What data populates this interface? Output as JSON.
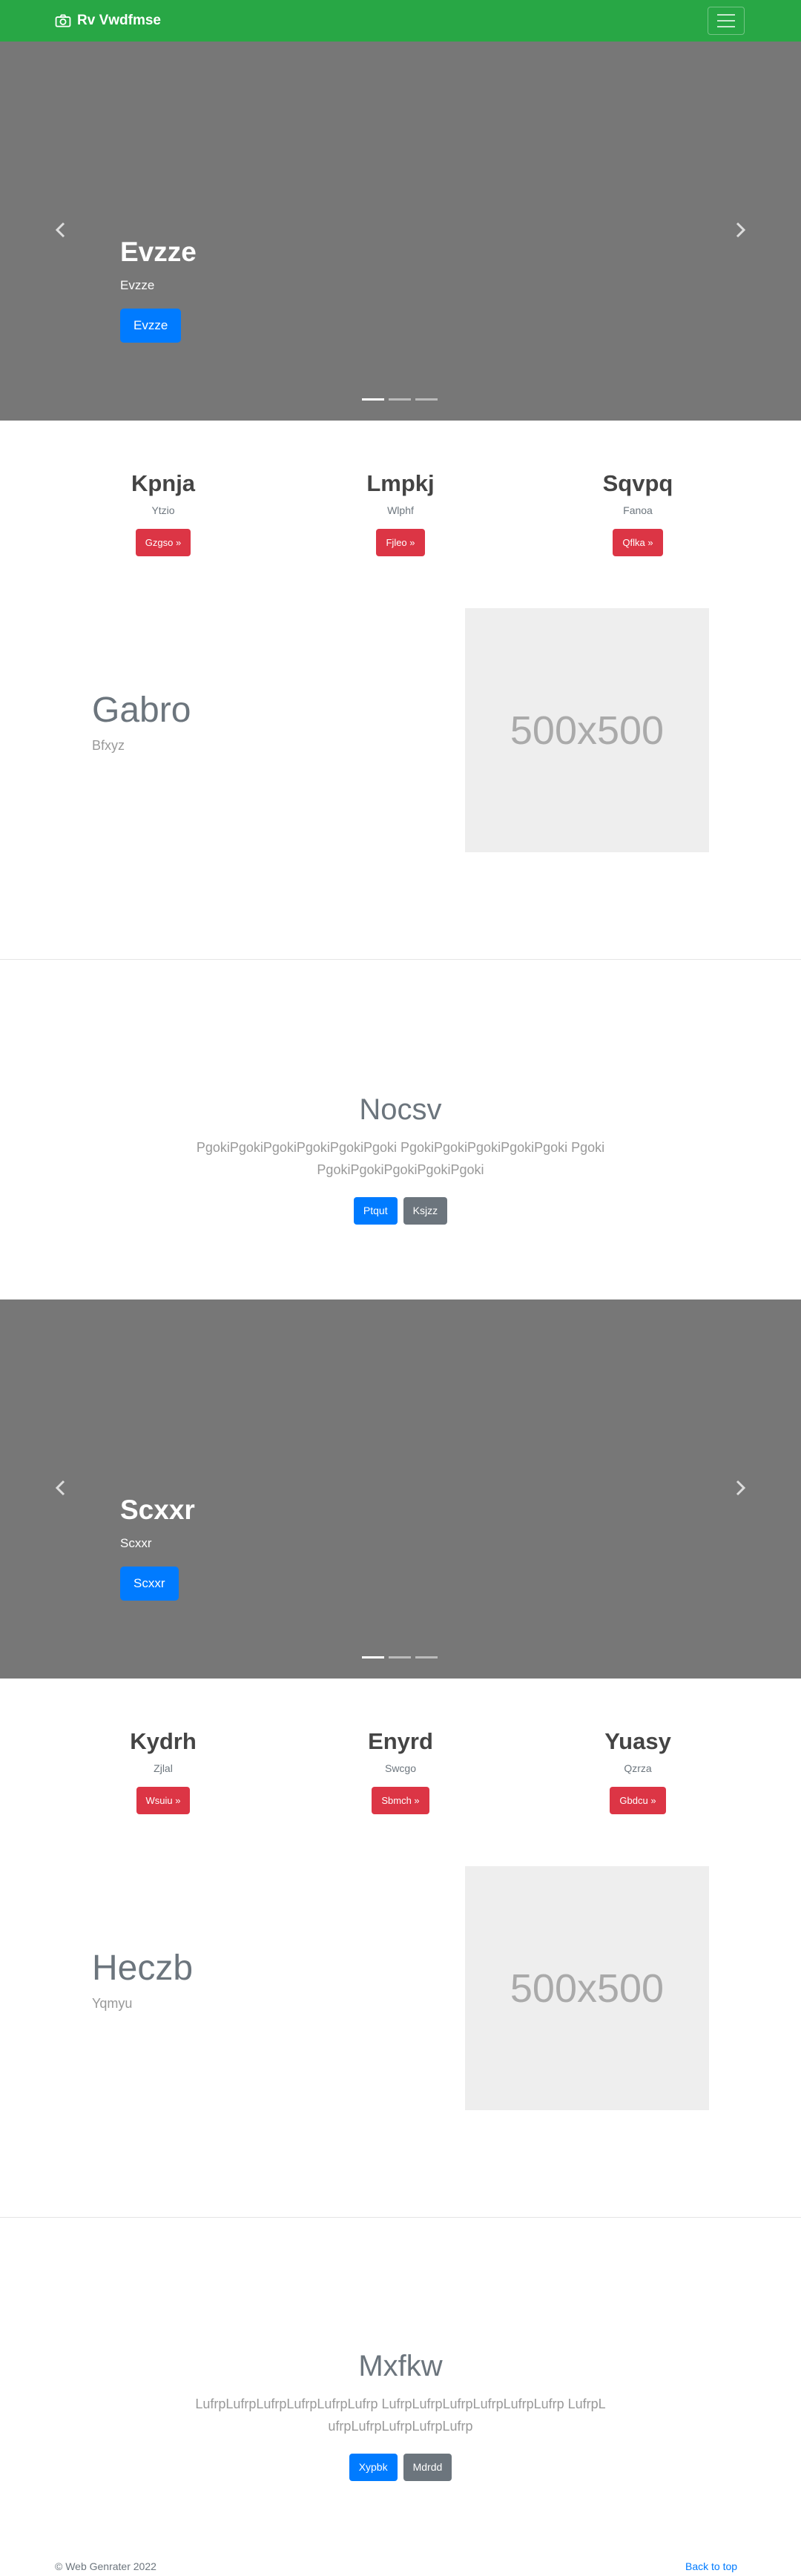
{
  "navbar": {
    "brand": "Rv Vwdfmse",
    "brand_icon": "camera-icon",
    "toggler_icon": "hamburger-menu-icon",
    "color": "#28a745"
  },
  "carousel1": {
    "title": "Evzze",
    "subtitle": "Evzze",
    "button": "Evzze",
    "active_slide": 1,
    "slide_count": 3
  },
  "features1": [
    {
      "title": "Kpnja",
      "subtitle": "Ytzio",
      "button": "Gzgso »"
    },
    {
      "title": "Lmpkj",
      "subtitle": "Wlphf",
      "button": "Fjleo »"
    },
    {
      "title": "Sqvpq",
      "subtitle": "Fanoa",
      "button": "Qflka »"
    }
  ],
  "featurette1": {
    "heading": "Gabro",
    "subheading": "Bfxyz",
    "image_label": "500x500"
  },
  "jumbotron1": {
    "title": "Nocsv",
    "text": "PgokiPgokiPgokiPgokiPgokiPgoki PgokiPgokiPgokiPgokiPgoki PgokiPgokiPgokiPgokiPgokiPgoki",
    "primary_button": "Ptqut",
    "secondary_button": "Ksjzz"
  },
  "carousel2": {
    "title": "Scxxr",
    "subtitle": "Scxxr",
    "button": "Scxxr",
    "active_slide": 1,
    "slide_count": 3
  },
  "features2": [
    {
      "title": "Kydrh",
      "subtitle": "Zjlal",
      "button": "Wsuiu »"
    },
    {
      "title": "Enyrd",
      "subtitle": "Swcgo",
      "button": "Sbmch »"
    },
    {
      "title": "Yuasy",
      "subtitle": "Qzrza",
      "button": "Gbdcu »"
    }
  ],
  "featurette2": {
    "heading": "Heczb",
    "subheading": "Yqmyu",
    "image_label": "500x500"
  },
  "jumbotron2": {
    "title": "Mxfkw",
    "text": "LufrpLufrpLufrpLufrpLufrpLufrp LufrpLufrpLufrpLufrpLufrpLufrp LufrpLufrpLufrpLufrpLufrpLufrp",
    "primary_button": "Xypbk",
    "secondary_button": "Mdrdd"
  },
  "footer": {
    "copyright": "© Web Genrater 2022",
    "back_to_top": "Back to top"
  },
  "colors": {
    "primary": "#007bff",
    "danger": "#dc3545",
    "secondary": "#6c757d",
    "carousel_bg": "#777777"
  }
}
